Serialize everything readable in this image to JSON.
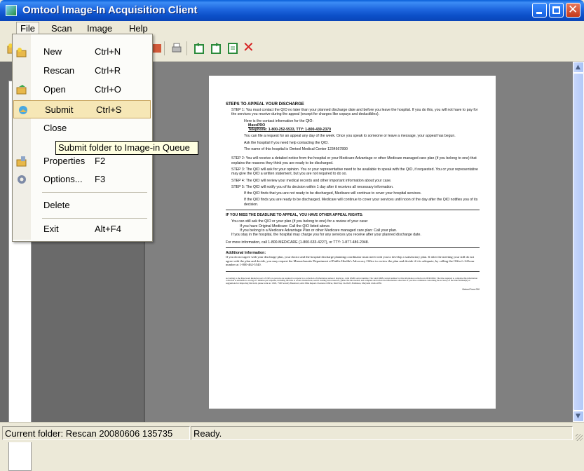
{
  "window": {
    "title": "Omtool Image-In Acquisition Client"
  },
  "menubar": {
    "items": [
      "File",
      "Scan",
      "Image",
      "Help"
    ]
  },
  "file_menu": {
    "items": [
      {
        "label": "New",
        "shortcut": "Ctrl+N",
        "icon": "new-folder-icon"
      },
      {
        "label": "Rescan",
        "shortcut": "Ctrl+R",
        "icon": ""
      },
      {
        "label": "Open",
        "shortcut": "Ctrl+O",
        "icon": "open-folder-icon"
      },
      {
        "label": "Submit",
        "shortcut": "Ctrl+S",
        "icon": "submit-icon",
        "selected": true
      },
      {
        "label": "Close",
        "shortcut": "",
        "icon": ""
      },
      {
        "label": "Properties",
        "shortcut": "F2",
        "icon": "properties-icon"
      },
      {
        "label": "Options...",
        "shortcut": "F3",
        "icon": "gear-icon"
      },
      {
        "label": "Delete",
        "shortcut": "",
        "icon": ""
      },
      {
        "label": "Exit",
        "shortcut": "Alt+F4",
        "icon": ""
      }
    ]
  },
  "tooltip": {
    "text": "Submit folder to Image-in Queue"
  },
  "toolbar": {
    "icons": [
      "scan-icon",
      "print-icon",
      "rotate-left-icon",
      "rotate-right-icon",
      "page-icon",
      "delete-icon"
    ]
  },
  "document": {
    "heading": "STEPS TO APPEAL YOUR DISCHARGE",
    "step1": "STEP 1: You must contact the QIO no later than your planned discharge date and before you leave the hospital. If you do this, you will not have to pay for the services you receive during the appeal (except for charges like copays and deductibles).",
    "contact_label": "Here is the contact information for the QIO:",
    "contact_org": "MassPRO",
    "contact_phone": "Telephone: 1-800-252-5533,  TTY: 1-800-439-2370",
    "bullet_request": "You can file a request for an appeal any day of the week. Once you speak to someone or leave a message, your appeal has begun.",
    "bullet_help": "Ask the hospital if you need help contacting the QIO.",
    "bullet_name": "The name of this hospital is Omtool Medical Center    1234567890",
    "step2": "STEP 2: You will receive a detailed notice from the hospital or your Medicare Advantage or other Medicare managed care plan (if you belong to one) that explains the reasons they think you are ready to be discharged.",
    "step3": "STEP 3: The QIO will ask for your opinion. You or your representative need to be available to speak with the QIO, if requested. You or your representative may give the QIO a written statement, but you are not required to do so.",
    "step4": "STEP 4: The QIO will review your medical records and other important information about your case.",
    "step5": "STEP 5: The QIO will notify you of its decision within 1 day after it receives all necessary information.",
    "step5_a": "If the QIO finds that you are not ready to be discharged, Medicare will continue to cover your hospital services.",
    "step5_b": "If the QIO finds you are ready to be discharged, Medicare will continue to cover your services until noon of the day after the QIO notifies you of its decision.",
    "missed_heading": "IF YOU MISS THE DEADLINE TO APPEAL, YOU HAVE OTHER APPEAL RIGHTS:",
    "missed_1": "You can still ask the QIO or your plan (if you belong to one) for a review of your case:",
    "missed_1a": "If you have Original Medicare: Call the QIO listed above.",
    "missed_1b": "If you belong to a Medicare Advantage Plan or other Medicare managed care plan: Call your plan.",
    "missed_2": "If you stay in the hospital, the hospital may charge you for any services you receive after your planned discharge date.",
    "more_info": "For more information, call 1-800-MEDICARE (1-800-633-4227), or TTY: 1-877-486-2048.",
    "additional_heading": "Additional Information:",
    "additional_text": "If you do not agree with your discharge plan, your doctor and the hospital discharge planning coordinator must meet with you to develop a satisfactory plan. If after the meeting your still do not agree with the plan and decide, you may request the Massachusetts Department of Public Health's Advocacy Office to review the plan and decide if it is adequate, by calling the Office's 24 hour number at 1-800-462-5540.",
    "footer_text": "According to the Paperwork Reduction Act of 1995, no persons are required to respond to a collection of information unless it displays a valid OMB control number. The valid OMB control number for this information collection is 0938-0692. The time required to complete this information collection is estimated to average 15 minutes per response, including the time to review instructions, search existing data resources, gather the data needed, and complete and review the information collection. If you have comments concerning the accuracy of the time estimate(s) or suggestions for improving this form, please write to: CMS, 7500 Security Boulevard, Attn: PRA Reports Clearance Officer, Mail Stop C4-26-05, Baltimore, Maryland 21244-1850.",
    "form_number": "Omtool Form 000"
  },
  "statusbar": {
    "folder": "Current folder: Rescan 20080606 135735",
    "status": "Ready."
  }
}
